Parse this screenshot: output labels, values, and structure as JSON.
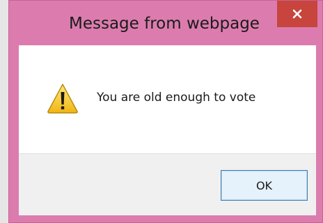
{
  "dialog": {
    "title": "Message from webpage",
    "message": "You are old enough to vote",
    "ok_label": "OK",
    "close_icon": "close-icon",
    "message_icon": "warning-icon"
  },
  "colors": {
    "title_bar": "#dc7cae",
    "close_button": "#c7453c",
    "footer": "#f0f0f0",
    "ok_button_border": "#3c7fb1"
  }
}
